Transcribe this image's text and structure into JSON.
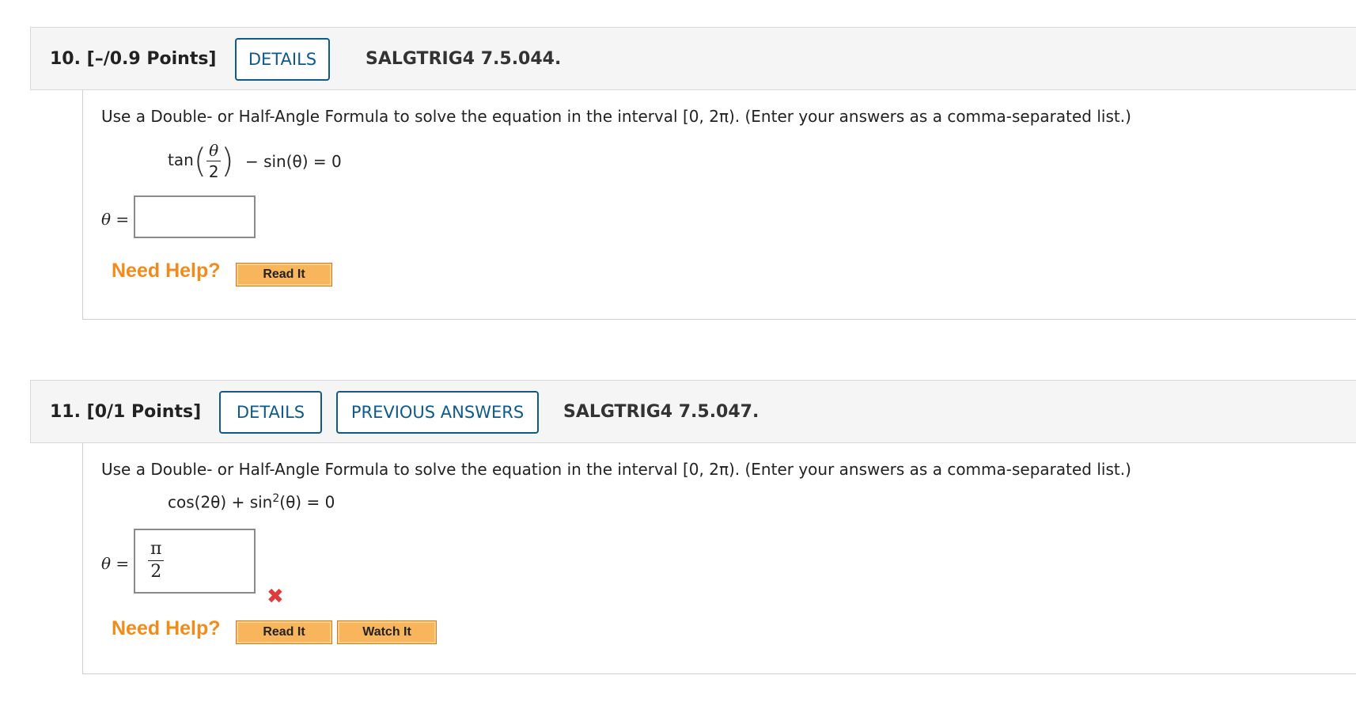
{
  "questions": [
    {
      "number": "10.",
      "points": "[–/0.9 Points]",
      "details_label": "DETAILS",
      "code": "SALGTRIG4 7.5.044.",
      "prompt": "Use a Double- or Half-Angle Formula to solve the equation in the interval [0, 2π). (Enter your answers as a comma-separated list.)",
      "equation": {
        "func": "tan",
        "frac_num": "θ",
        "frac_den": "2",
        "rest": "− sin(θ) = 0"
      },
      "answer_label": "θ =",
      "answer_value": "",
      "need_help": "Need Help?",
      "help_buttons": [
        "Read It"
      ]
    },
    {
      "number": "11.",
      "points": "[0/1 Points]",
      "details_label": "DETAILS",
      "previous_answers_label": "PREVIOUS ANSWERS",
      "code": "SALGTRIG4 7.5.047.",
      "prompt": "Use a Double- or Half-Angle Formula to solve the equation in the interval [0, 2π). (Enter your answers as a comma-separated list.)",
      "equation": {
        "part1": "cos(2θ) + sin",
        "exp": "2",
        "part2": "(θ) = 0"
      },
      "answer_label": "θ =",
      "answer_value": {
        "num": "π",
        "den": "2"
      },
      "answer_status": "incorrect",
      "status_icon": "✖",
      "need_help": "Need Help?",
      "help_buttons": [
        "Read It",
        "Watch It"
      ]
    }
  ],
  "colors": {
    "accent": "#0e5a8a",
    "need_help": "#f28b1a",
    "help_button": "#f8b55b",
    "incorrect": "#e03a3a"
  }
}
